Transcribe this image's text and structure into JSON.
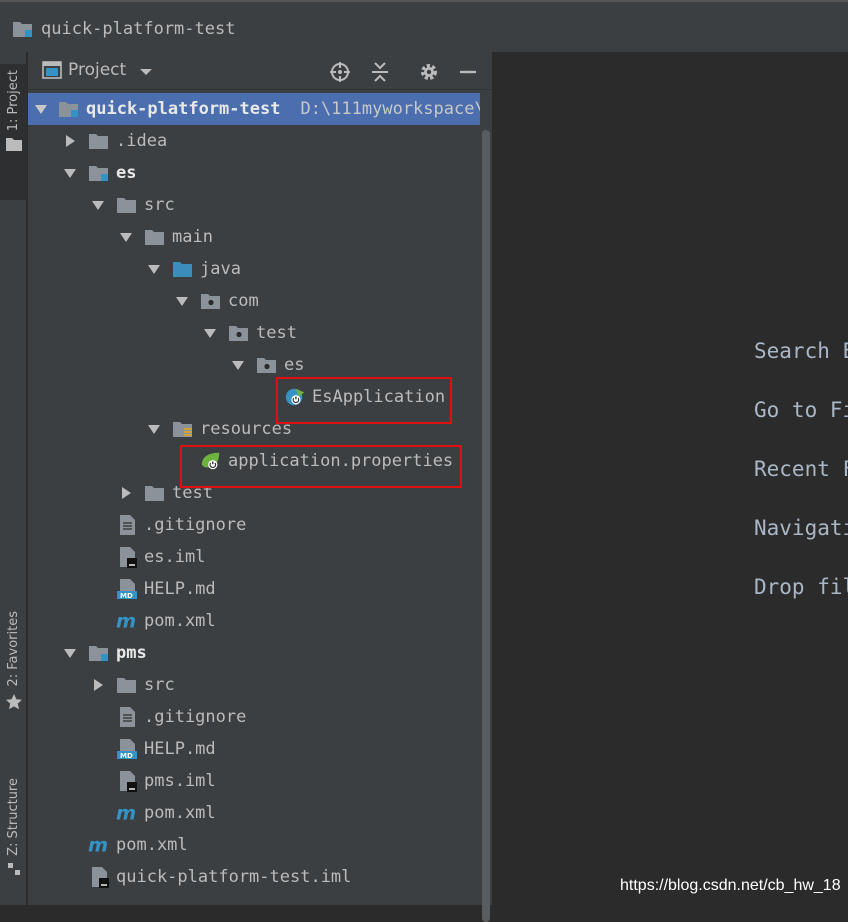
{
  "window": {
    "title": "quick-platform-test"
  },
  "sidebar_tabs": {
    "project": "1: Project",
    "favorites": "2: Favorites",
    "structure": "Z: Structure"
  },
  "panel": {
    "title": "Project"
  },
  "tree": {
    "root": {
      "name": "quick-platform-test",
      "path": "D:\\111myworkspace\\qu"
    },
    "idea": ".idea",
    "es": "es",
    "es_src": "src",
    "es_main": "main",
    "es_java": "java",
    "es_com": "com",
    "es_test_pkg": "test",
    "es_es_pkg": "es",
    "es_app": "EsApplication",
    "es_resources": "resources",
    "es_props": "application.properties",
    "es_test_dir": "test",
    "es_gitignore": ".gitignore",
    "es_iml": "es.iml",
    "es_help": "HELP.md",
    "es_pom": "pom.xml",
    "pms": "pms",
    "pms_src": "src",
    "pms_gitignore": ".gitignore",
    "pms_help": "HELP.md",
    "pms_iml": "pms.iml",
    "pms_pom": "pom.xml",
    "root_pom": "pom.xml",
    "root_iml": "quick-platform-test.iml"
  },
  "editor_hints": [
    "Search E",
    "Go to Fi",
    "Recent F",
    "Navigati",
    "Drop fil"
  ],
  "watermark": "https://blog.csdn.net/cb_hw_18",
  "colors": {
    "selection": "#4b6eaf",
    "highlight_box": "#e01010",
    "folder": "#8b9299",
    "source_folder": "#3c8dbc"
  }
}
